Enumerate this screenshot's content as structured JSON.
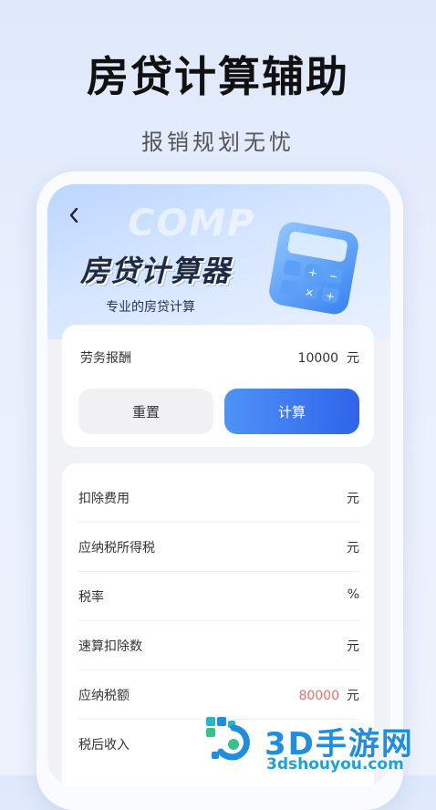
{
  "promo": {
    "title": "房贷计算辅助",
    "subtitle": "报销规划无忧"
  },
  "header": {
    "back_icon": "chevron-left-icon",
    "watermark": "COMP",
    "title": "房贷计算器",
    "subtitle": "专业的房贷计算"
  },
  "input_card": {
    "label": "劳务报酬",
    "value": "10000",
    "unit": "元",
    "reset_label": "重置",
    "calc_label": "计算"
  },
  "results": [
    {
      "label": "扣除费用",
      "value": "",
      "unit": "元"
    },
    {
      "label": "应纳税所得税",
      "value": "",
      "unit": "元"
    },
    {
      "label": "税率",
      "value": "",
      "unit": "%"
    },
    {
      "label": "速算扣除数",
      "value": "",
      "unit": "元"
    },
    {
      "label": "应纳税额",
      "value": "80000",
      "unit": "元"
    },
    {
      "label": "税后收入",
      "value": "",
      "unit": ""
    }
  ],
  "colors": {
    "accent": "#3b7cf0",
    "highlight": "#f06a6a"
  },
  "watermark_brand": {
    "name": "3D手游网",
    "url": "3dshouyou.com"
  }
}
